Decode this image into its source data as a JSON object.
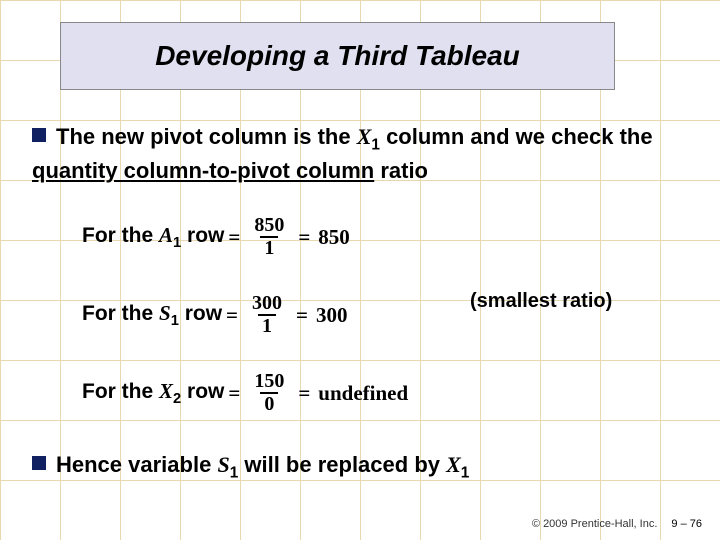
{
  "title": "Developing a Third Tableau",
  "bullet1": {
    "prefix": "The new pivot column is the ",
    "var": "X",
    "varsub": "1",
    "mid": " column and we check the ",
    "underlined": "quantity column-to-pivot column",
    "suffix": " ratio"
  },
  "rows": [
    {
      "label_prefix": "For the ",
      "label_var": "A",
      "label_sub": "1",
      "label_suffix": " row",
      "num": "850",
      "den": "1",
      "result": "850"
    },
    {
      "label_prefix": "For the ",
      "label_var": "S",
      "label_sub": "1",
      "label_suffix": " row",
      "num": "300",
      "den": "1",
      "result": "300"
    },
    {
      "label_prefix": "For the ",
      "label_var": "X",
      "label_sub": "2",
      "label_suffix": " row",
      "num": "150",
      "den": "0",
      "result": "undefined"
    }
  ],
  "note": "(smallest ratio)",
  "bullet2": {
    "prefix": "Hence variable ",
    "v1": "S",
    "v1sub": "1",
    "mid": " will be replaced by ",
    "v2": "X",
    "v2sub": "1"
  },
  "footer": {
    "copyright": "© 2009 Prentice-Hall, Inc.",
    "page": "9 – 76"
  },
  "eq": "="
}
